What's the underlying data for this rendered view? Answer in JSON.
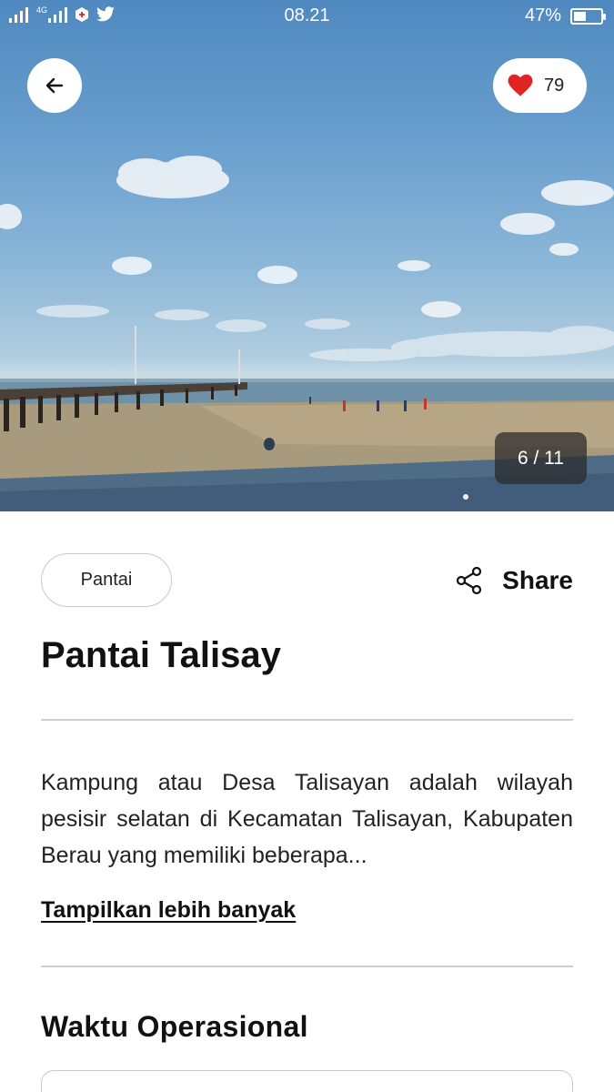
{
  "status_bar": {
    "time": "08.21",
    "battery": "47%",
    "battery_level": 0.47,
    "network": "4G",
    "icons": [
      "signal-icon",
      "signal-4g-icon",
      "notification-icon",
      "twitter-icon"
    ]
  },
  "hero": {
    "image_alt": "Beach with pier under blue sky",
    "favorite_count": "79",
    "image_counter": "6 / 11"
  },
  "place": {
    "category": "Pantai",
    "share_label": "Share",
    "title": "Pantai Talisay",
    "description": "Kampung atau Desa Talisayan adalah wilayah pesisir selatan di Kecamatan Talisayan, Kabupaten Berau yang memiliki beberapa...",
    "show_more": "Tampilkan lebih banyak",
    "hours_section_title": "Waktu Operasional"
  },
  "colors": {
    "heart": "#e02424",
    "divider": "#cfcfcf",
    "sky": "#5a93c6"
  }
}
